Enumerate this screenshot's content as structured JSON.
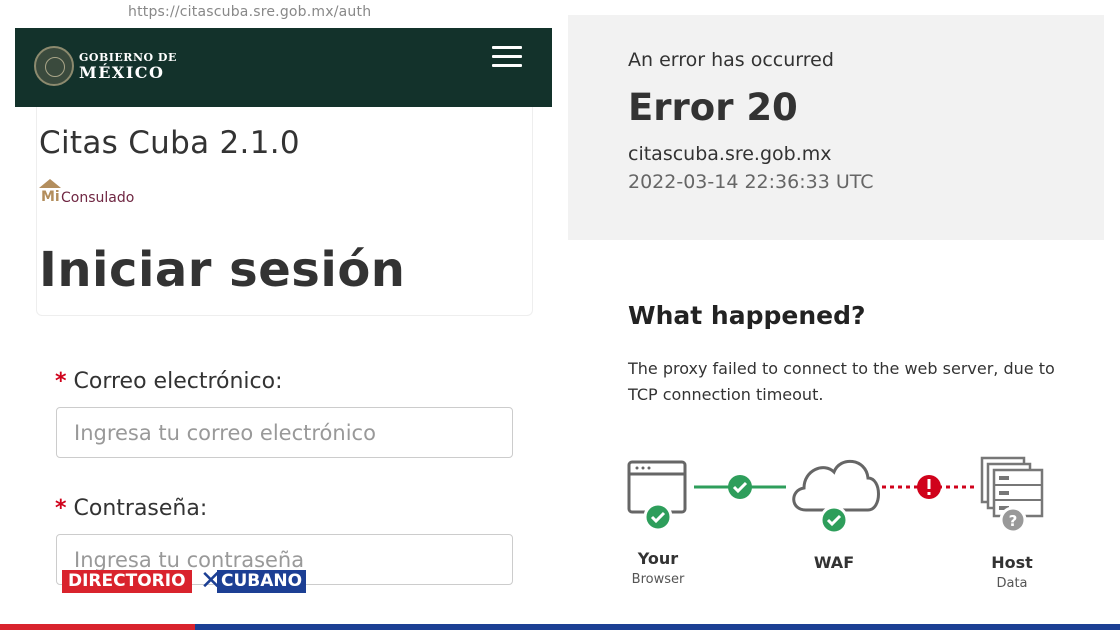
{
  "left": {
    "url": "https://citascuba.sre.gob.mx/auth",
    "header": {
      "line1": "GOBIERNO DE",
      "line2": "MÉXICO"
    },
    "app_title": "Citas Cuba 2.1.0",
    "logo": {
      "mi": "Mi",
      "consulado": "Consulado"
    },
    "login_heading": "Iniciar sesión",
    "email": {
      "required_mark": "*",
      "label": "Correo electrónico:",
      "placeholder": "Ingresa tu correo electrónico"
    },
    "password": {
      "required_mark": "*",
      "label": "Contraseña:",
      "placeholder": "Ingresa tu contraseña"
    },
    "watermark": {
      "left": "DIRECTORIO",
      "right": "CUBANO"
    }
  },
  "right": {
    "error_subtitle": "An error has occurred",
    "error_code": "Error 20",
    "host": "citascuba.sre.gob.mx",
    "timestamp": "2022-03-14 22:36:33 UTC",
    "what_title": "What happened?",
    "what_desc": "The proxy failed to connect to the web server, due to TCP connection timeout.",
    "diagram": {
      "browser": {
        "title": "Your",
        "sub": "Browser",
        "status": "ok"
      },
      "waf": {
        "title": "WAF",
        "status": "ok"
      },
      "host": {
        "title": "Host",
        "sub": "Data",
        "status": "unknown"
      },
      "link_browser_waf": "ok",
      "link_waf_host": "error"
    }
  },
  "colors": {
    "gov_green": "#13322b",
    "ok_green": "#2e9e5b",
    "error_red": "#d0021b",
    "stripe_red": "#d9232d",
    "stripe_blue": "#1c3f94"
  }
}
